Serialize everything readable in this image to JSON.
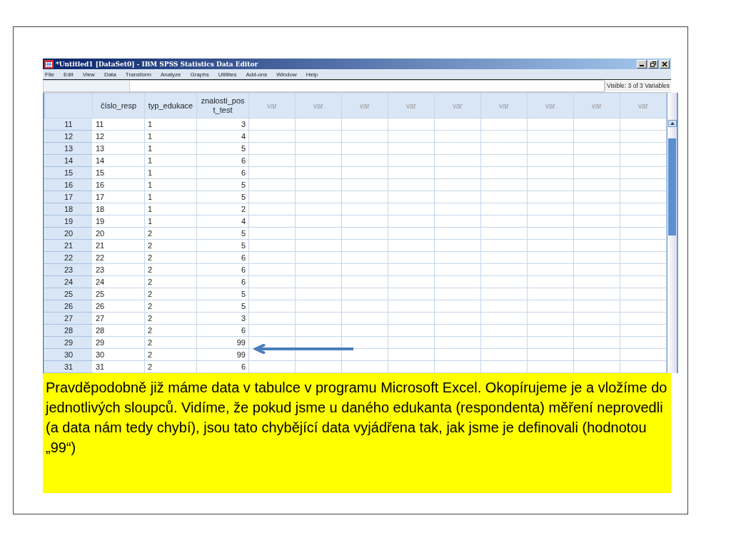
{
  "window": {
    "title": "*Untitled1 [DataSet0] - IBM SPSS Statistics Data Editor"
  },
  "menu": [
    "File",
    "Edit",
    "View",
    "Data",
    "Transform",
    "Analyze",
    "Graphs",
    "Utilities",
    "Add-ons",
    "Window",
    "Help"
  ],
  "status": "Visible: 3 of 3 Variables",
  "columns": [
    {
      "label": "číslo_resp",
      "kind": "string"
    },
    {
      "label": "typ_edukace",
      "kind": "string"
    },
    {
      "label": "znalosti_post_test",
      "kind": "numeric"
    },
    {
      "label": "var",
      "kind": "empty"
    },
    {
      "label": "var",
      "kind": "empty"
    },
    {
      "label": "var",
      "kind": "empty"
    },
    {
      "label": "var",
      "kind": "empty"
    },
    {
      "label": "var",
      "kind": "empty"
    },
    {
      "label": "var",
      "kind": "empty"
    },
    {
      "label": "var",
      "kind": "empty"
    },
    {
      "label": "var",
      "kind": "empty"
    },
    {
      "label": "var",
      "kind": "empty"
    }
  ],
  "rows": [
    {
      "number": "11",
      "cells": [
        "11",
        "1",
        "3"
      ]
    },
    {
      "number": "12",
      "cells": [
        "12",
        "1",
        "4"
      ]
    },
    {
      "number": "13",
      "cells": [
        "13",
        "1",
        "5"
      ]
    },
    {
      "number": "14",
      "cells": [
        "14",
        "1",
        "6"
      ]
    },
    {
      "number": "15",
      "cells": [
        "15",
        "1",
        "6"
      ]
    },
    {
      "number": "16",
      "cells": [
        "16",
        "1",
        "5"
      ]
    },
    {
      "number": "17",
      "cells": [
        "17",
        "1",
        "5"
      ]
    },
    {
      "number": "18",
      "cells": [
        "18",
        "1",
        "2"
      ]
    },
    {
      "number": "19",
      "cells": [
        "19",
        "1",
        "4"
      ]
    },
    {
      "number": "20",
      "cells": [
        "20",
        "2",
        "5"
      ]
    },
    {
      "number": "21",
      "cells": [
        "21",
        "2",
        "5"
      ]
    },
    {
      "number": "22",
      "cells": [
        "22",
        "2",
        "6"
      ]
    },
    {
      "number": "23",
      "cells": [
        "23",
        "2",
        "6"
      ]
    },
    {
      "number": "24",
      "cells": [
        "24",
        "2",
        "6"
      ]
    },
    {
      "number": "25",
      "cells": [
        "25",
        "2",
        "5"
      ]
    },
    {
      "number": "26",
      "cells": [
        "26",
        "2",
        "5"
      ]
    },
    {
      "number": "27",
      "cells": [
        "27",
        "2",
        "3"
      ]
    },
    {
      "number": "28",
      "cells": [
        "28",
        "2",
        "6"
      ]
    },
    {
      "number": "29",
      "cells": [
        "29",
        "2",
        "99"
      ]
    },
    {
      "number": "30",
      "cells": [
        "30",
        "2",
        "99"
      ]
    },
    {
      "number": "31",
      "cells": [
        "31",
        "2",
        "6"
      ]
    }
  ],
  "caption": "Pravděpodobně již máme data v tabulce v programu Microsoft Excel. Okopírujeme je a vložíme do jednotlivých sloupců. Vidíme, že pokud jsme u daného edukanta (respondenta) měření neprovedli (a data nám tedy chybí), jsou tato chybějící data vyjádřena tak, jak jsme je definovali (hodnotou „99“)"
}
